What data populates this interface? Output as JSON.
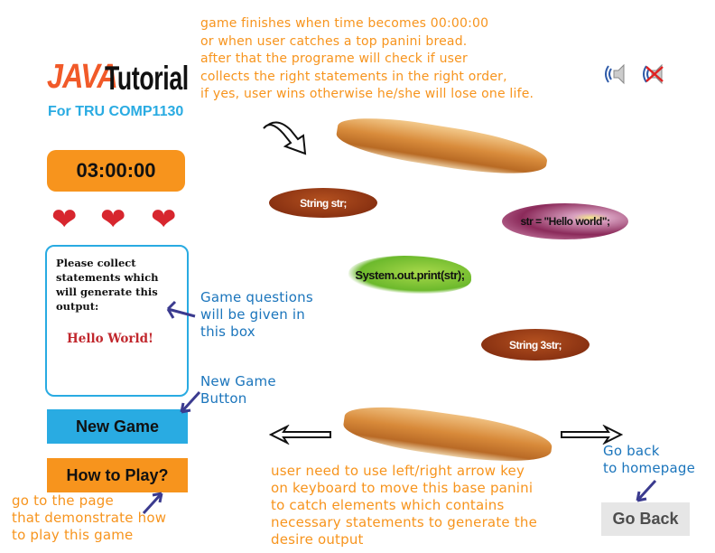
{
  "logo": {
    "java": "JAVA",
    "tutorial": "Tutorial",
    "subtitle": "For TRU COMP1130"
  },
  "timer": {
    "value": "03:00:00"
  },
  "lives": {
    "count": 3,
    "icon": "heart-icon",
    "color": "#d7262e"
  },
  "question_box": {
    "prompt": "Please collect statements which will generate this output:",
    "expected_output": "Hello World!"
  },
  "buttons": {
    "new_game": "New Game",
    "how_to_play": "How to Play?",
    "go_back": "Go Back"
  },
  "sound": {
    "on_icon": "speaker-on-icon",
    "off_icon": "speaker-muted-icon"
  },
  "food_items": [
    {
      "type": "sausage",
      "label": "String str;"
    },
    {
      "type": "onion",
      "label": "str = \"Hello world\";"
    },
    {
      "type": "lettuce",
      "label": "System.out.print(str);"
    },
    {
      "type": "sausage",
      "label": "String 3str;"
    }
  ],
  "annotations": {
    "top": "game finishes when time becomes 00:00:00\nor when user catches a top panini bread.\nafter that the programe will check if user\ncollects the right statements in the right order,\nif yes, user wins otherwise he/she will lose one life.",
    "question_box": "Game questions\nwill be given in\nthis box",
    "new_game": "New Game\nButton",
    "how_to_play": "go to the page\nthat demonstrate how\nto play this game",
    "controls": "user need to use left/right arrow key\non keyboard to move this base panini\nto catch elements which contains\nnecessary statements to generate the\ndesire output",
    "go_back": "Go back\nto homepage"
  },
  "colors": {
    "orange": "#f7941d",
    "blue": "#29abe2",
    "annotation_blue": "#1b75bc",
    "go_back_bg": "#e6e6e6"
  }
}
